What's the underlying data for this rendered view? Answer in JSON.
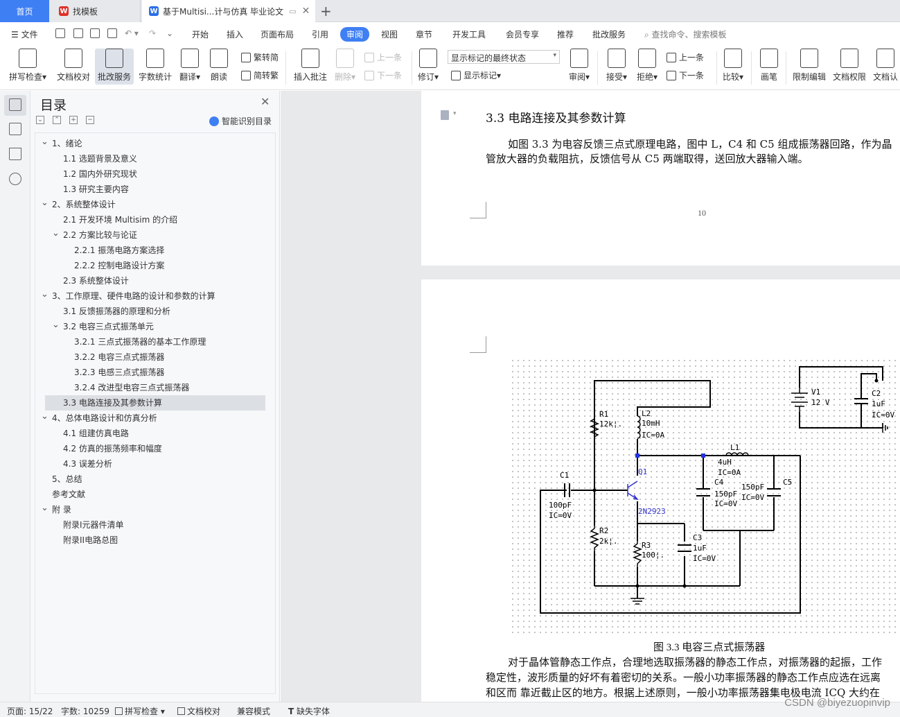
{
  "tabs": {
    "home": "首页",
    "template": "找模板",
    "document": "基于Multisi...计与仿真 毕业论文"
  },
  "menu": {
    "file": "文件",
    "items": [
      "开始",
      "插入",
      "页面布局",
      "引用",
      "审阅",
      "视图",
      "章节",
      "开发工具",
      "会员专享",
      "推荐",
      "批改服务"
    ],
    "active": "审阅",
    "search": "查找命令、搜索模板"
  },
  "ribbon": {
    "spell_check": "拼写检查",
    "doc_proof": "文档校对",
    "review_service": "批改服务",
    "word_count": "字数统计",
    "translate": "翻译",
    "read_aloud": "朗读",
    "trad_to_simp": "繁转简",
    "simp_to_trad": "简转繁",
    "insert_comment": "插入批注",
    "delete": "删除",
    "prev": "上一条",
    "next": "下一条",
    "revise": "修订",
    "markup_state": "显示标记的最终状态",
    "show_markup": "显示标记",
    "review": "审阅",
    "accept": "接受",
    "reject": "拒绝",
    "prev2": "上一条",
    "next2": "下一条",
    "compare": "比较",
    "pen": "画笔",
    "restrict_edit": "限制编辑",
    "doc_rights": "文档权限",
    "doc_auth": "文档认"
  },
  "toc": {
    "title": "目录",
    "smart": "智能识别目录",
    "items": [
      {
        "label": "1、绪论",
        "level": 1,
        "arrow": true
      },
      {
        "label": "1.1 选题背景及意义",
        "level": 2,
        "arrow": false
      },
      {
        "label": "1.2 国内外研究现状",
        "level": 2,
        "arrow": false
      },
      {
        "label": "1.3 研究主要内容",
        "level": 2,
        "arrow": false
      },
      {
        "label": "2、系统整体设计",
        "level": 1,
        "arrow": true
      },
      {
        "label": "2.1 开发环境 Multisim 的介绍",
        "level": 2,
        "arrow": false
      },
      {
        "label": "2.2 方案比较与论证",
        "level": 2,
        "arrow": true
      },
      {
        "label": "2.2.1 振荡电路方案选择",
        "level": 3,
        "arrow": false
      },
      {
        "label": "2.2.2  控制电路设计方案",
        "level": 3,
        "arrow": false
      },
      {
        "label": "2.3 系统整体设计",
        "level": 2,
        "arrow": false
      },
      {
        "label": "3、工作原理、硬件电路的设计和参数的计算",
        "level": 1,
        "arrow": true
      },
      {
        "label": "3.1  反馈振荡器的原理和分析",
        "level": 2,
        "arrow": false
      },
      {
        "label": "3.2 电容三点式振荡单元",
        "level": 2,
        "arrow": true
      },
      {
        "label": "3.2.1 三点式振荡器的基本工作原理",
        "level": 3,
        "arrow": false
      },
      {
        "label": "3.2.2 电容三点式振荡器",
        "level": 3,
        "arrow": false
      },
      {
        "label": "3.2.3  电感三点式振荡器",
        "level": 3,
        "arrow": false
      },
      {
        "label": "3.2.4 改进型电容三点式振荡器",
        "level": 3,
        "arrow": false
      },
      {
        "label": "3.3  电路连接及其参数计算",
        "level": 2,
        "arrow": false,
        "selected": true
      },
      {
        "label": "4、总体电路设计和仿真分析",
        "level": 1,
        "arrow": true
      },
      {
        "label": "4.1 组建仿真电路",
        "level": 2,
        "arrow": false
      },
      {
        "label": "4.2 仿真的振荡频率和幅度",
        "level": 2,
        "arrow": false
      },
      {
        "label": "4.3 误差分析",
        "level": 2,
        "arrow": false
      },
      {
        "label": "5、总结",
        "level": 1,
        "arrow": false
      },
      {
        "label": "参考文献",
        "level": 0,
        "arrow": false
      },
      {
        "label": "附    录",
        "level": 1,
        "arrow": true
      },
      {
        "label": "附录I元器件清单",
        "level": 2,
        "arrow": false
      },
      {
        "label": "附录II电路总图",
        "level": 2,
        "arrow": false
      }
    ]
  },
  "document": {
    "heading": "3.3  电路连接及其参数计算",
    "para1_line1": "如图 3.3 为电容反馈三点式原理电路，图中 L，C4 和 C5 组成振荡器回路，作为晶",
    "para1_line2": "管放大器的负载阻抗，反馈信号从 C5 两端取得，送回放大器输入端。",
    "page_number": "10",
    "caption": "图 3.3 电容三点式振荡器",
    "para2_line1": "对于晶体管静态工作点，合理地选取振荡器的静态工作点，对振荡器的起振，工作",
    "para2_line2": "稳定性，波形质量的好坏有着密切的关系。一般小功率振荡器的静态工作点应选在远离",
    "para2_line3": "和区而  靠近截止区的地方。根据上述原则，一般小功率振荡器集电极电流  ICQ 大约在"
  },
  "circuit": {
    "r1": "R1",
    "r1v": "12k¦.",
    "l2": "L2",
    "l2v": "10mH",
    "l2ic": "IC=0A",
    "v1": "V1",
    "v1v": "12  V",
    "c2": "C2",
    "c2v": "1uF",
    "c2ic": "IC=0V",
    "l1": "L1",
    "l1v": "4uH",
    "l1ic": "IC=0A",
    "q1": "Q1",
    "q1model": "2N2923",
    "c1": "C1",
    "c1v": "100pF",
    "c1ic": "IC=0V",
    "c4": "C4",
    "c4v": "150pF",
    "c4ic": "IC=0V",
    "c5": "C5",
    "c5v": "150pF",
    "c5ic": "IC=0V",
    "r2": "R2",
    "r2v": "2k¦.",
    "r3": "R3",
    "r3v": "100¦.",
    "c3": "C3",
    "c3v": "1uF",
    "c3ic": "IC=0V"
  },
  "status": {
    "page": "页面: 15/22",
    "words": "字数: 10259",
    "spell": "拼写检查",
    "proof": "文档校对",
    "compat": "兼容模式",
    "missing_font": "缺失字体"
  },
  "watermark": "CSDN @biyezuopinvip",
  "colors": {
    "accent": "#3f7ff4",
    "circuit_blue": "#3333cc"
  }
}
